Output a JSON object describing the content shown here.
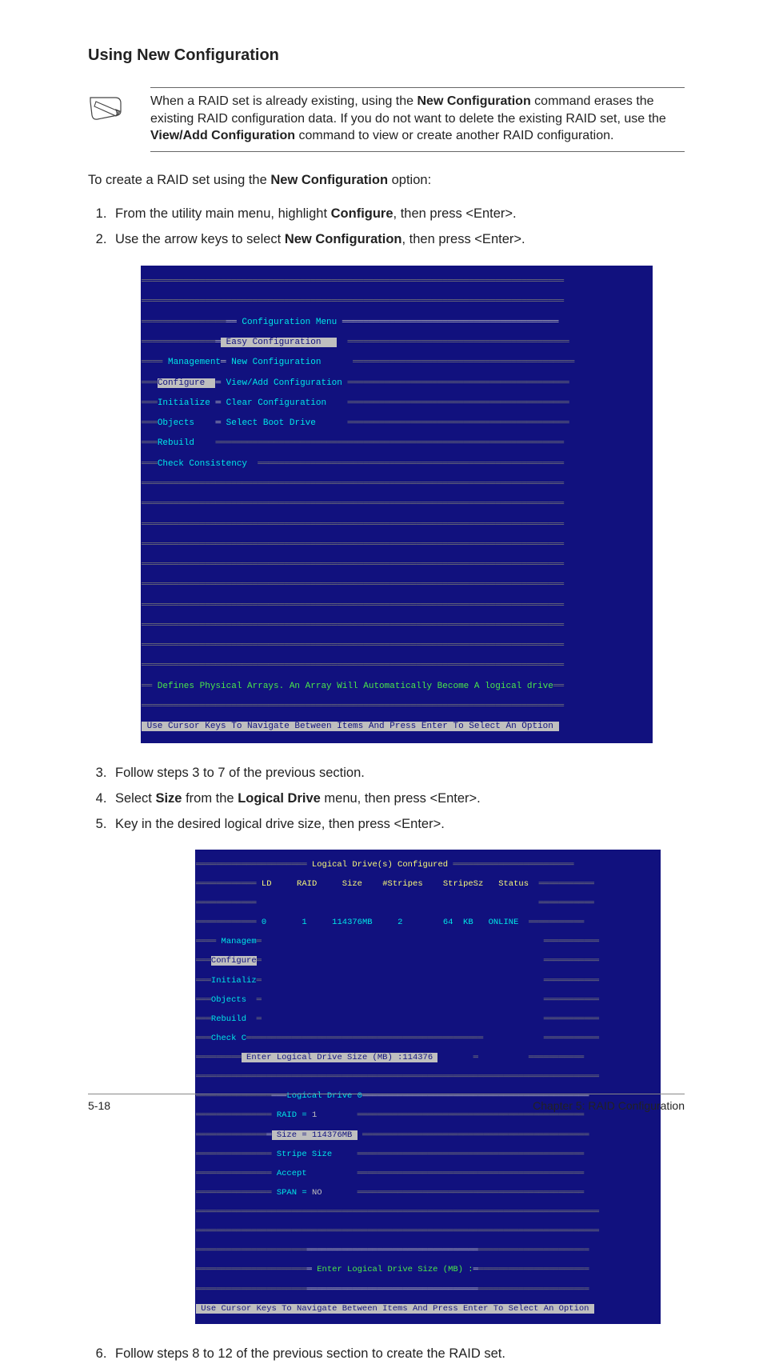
{
  "heading": "Using New Configuration",
  "note": {
    "p1a": "When a RAID set is already existing, using the ",
    "p1b": "New Configuration",
    "p1c": " command erases the existing RAID configuration data. If you do not want to delete the existing RAID set, use the ",
    "p1d": "View/Add Configuration",
    "p1e": " command to view or create another RAID configuration."
  },
  "intro": {
    "a": "To create a RAID set using the ",
    "b": "New Configuration",
    "c": " option:"
  },
  "steps1": {
    "s1a": "From the utility main menu, highlight ",
    "s1b": "Configure",
    "s1c": ", then press <Enter>.",
    "s2a": "Use the arrow keys to select ",
    "s2b": "New Configuration",
    "s2c": ", then press <Enter>."
  },
  "screen1": {
    "title": " Configuration Menu ",
    "easy_cfg": " Easy Configuration   ",
    "mgmt": " Management",
    "new_cfg": " New Configuration",
    "configure": "Configure  ",
    "view_add": " View/Add Configuration ",
    "initialize": "Initialize ",
    "clear_cfg": " Clear Configuration",
    "objects": "Objects    ",
    "select_boot": " Select Boot Drive",
    "rebuild": "Rebuild",
    "check_cons": "Check Consistency",
    "footer1": " Defines Physical Arrays. An Array Will Automatically Become A logical drive",
    "footer2": " Use Cursor Keys To Navigate Between Items And Press Enter To Select An Option "
  },
  "steps2": {
    "s3": "Follow steps 3 to 7 of the previous section.",
    "s4a": "Select ",
    "s4b": "Size",
    "s4c": " from the ",
    "s4d": "Logical Drive",
    "s4e": " menu, then press <Enter>.",
    "s5": "Key in the desired logical drive size, then press <Enter>."
  },
  "screen2": {
    "title": " Logical Drive(s) Configured ",
    "hdr_ld": " LD",
    "hdr_raid": "RAID",
    "hdr_size": "Size",
    "hdr_stripes": "#Stripes",
    "hdr_stripesz": "StripeSz",
    "hdr_status": "Status",
    "row_ld": " 0",
    "row_raid": "1",
    "row_size": "114376MB",
    "row_stripes": "2",
    "row_stripesz": "64  KB",
    "row_status": "ONLINE",
    "managem": " Managem",
    "configure": "Configure",
    "initializ": "Initializ",
    "objects": "Objects  ",
    "rebuild": "Rebuild  ",
    "check_c": "Check C",
    "enter_ld": " Enter Logical Drive Size (MB) :114376 ",
    "ld0": "Logical Drive 0",
    "raid_eq": " RAID = ",
    "raid_val": "1",
    "size_eq": " Size = ",
    "size_val": "114376MB ",
    "stripe_size": " Stripe Size",
    "accept": " Accept",
    "span_eq": " SPAN = ",
    "span_val": "NO",
    "enter_box": " Enter Logical Drive Size (MB) :",
    "footer": " Use Cursor Keys To Navigate Between Items And Press Enter To Select An Option "
  },
  "steps3": {
    "s6": "Follow steps 8 to 12 of the previous section to create the RAID set."
  },
  "footer": {
    "left": "5-18",
    "right": "Chapter 5: RAID Configuration"
  }
}
